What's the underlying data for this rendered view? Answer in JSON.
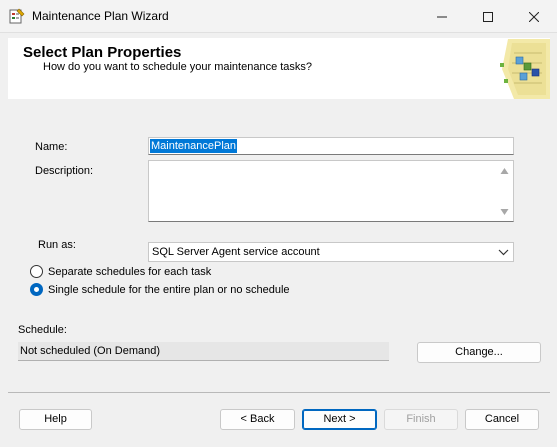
{
  "window": {
    "title": "Maintenance Plan Wizard"
  },
  "header": {
    "title": "Select Plan Properties",
    "subtitle": "How do you want to schedule your maintenance tasks?"
  },
  "form": {
    "name_label": "Name:",
    "name_value": "MaintenancePlan",
    "description_label": "Description:",
    "description_value": "",
    "run_as_label": "Run as:",
    "run_as_value": "SQL Server Agent service account"
  },
  "schedule_options": [
    {
      "label": "Separate schedules for each task",
      "checked": false
    },
    {
      "label": "Single schedule for the entire plan or no schedule",
      "checked": true
    }
  ],
  "schedule": {
    "label": "Schedule:",
    "value": "Not scheduled (On Demand)",
    "change_button": "Change..."
  },
  "buttons": {
    "help": "Help",
    "back": "< Back",
    "next": "Next >",
    "finish": "Finish",
    "cancel": "Cancel"
  },
  "colors": {
    "accent": "#0067c0",
    "selection": "#0078d7"
  }
}
